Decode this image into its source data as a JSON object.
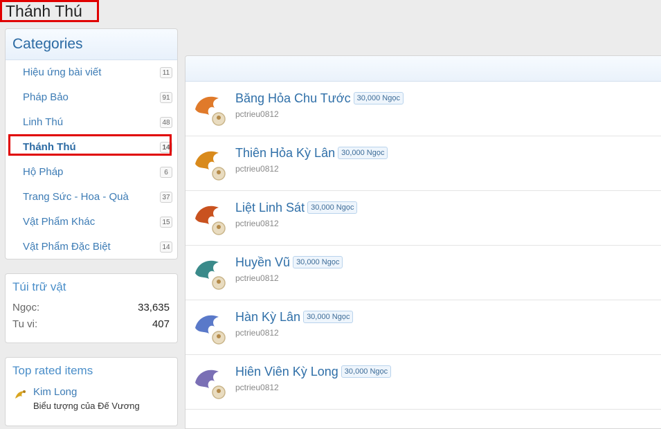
{
  "page": {
    "title": "Thánh Thú"
  },
  "categories": {
    "header": "Categories",
    "items": [
      {
        "label": "Hiệu ứng bài viết",
        "count": "11"
      },
      {
        "label": "Pháp Bảo",
        "count": "91"
      },
      {
        "label": "Linh Thú",
        "count": "48"
      },
      {
        "label": "Thánh Thú",
        "count": "14"
      },
      {
        "label": "Hộ Pháp",
        "count": "6"
      },
      {
        "label": "Trang Sức - Hoa - Quà",
        "count": "37"
      },
      {
        "label": "Vật Phẩm Khác",
        "count": "15"
      },
      {
        "label": "Vật Phẩm Đặc Biệt",
        "count": "14"
      }
    ]
  },
  "bag": {
    "title": "Túi trữ vật",
    "rows": [
      {
        "label": "Ngọc:",
        "value": "33,635"
      },
      {
        "label": "Tu vi:",
        "value": "407"
      }
    ]
  },
  "top_rated": {
    "title": "Top rated items",
    "items": [
      {
        "name": "Kim Long",
        "desc": "Biểu tượng của Đế Vương"
      }
    ]
  },
  "items": [
    {
      "name": "Băng Hỏa Chu Tước",
      "price": "30,000 Ngọc",
      "seller": "pctrieu0812",
      "color": "#e07a2a"
    },
    {
      "name": "Thiên Hỏa Kỳ Lân",
      "price": "30,000 Ngọc",
      "seller": "pctrieu0812",
      "color": "#d98a1c"
    },
    {
      "name": "Liệt Linh Sát",
      "price": "30,000 Ngọc",
      "seller": "pctrieu0812",
      "color": "#c9521f"
    },
    {
      "name": "Huyền Vũ",
      "price": "30,000 Ngọc",
      "seller": "pctrieu0812",
      "color": "#3a8a8a"
    },
    {
      "name": "Hàn Kỳ Lân",
      "price": "30,000 Ngọc",
      "seller": "pctrieu0812",
      "color": "#5a79c9"
    },
    {
      "name": "Hiên Viên Kỳ Long",
      "price": "30,000 Ngọc",
      "seller": "pctrieu0812",
      "color": "#7a6fb5"
    }
  ]
}
